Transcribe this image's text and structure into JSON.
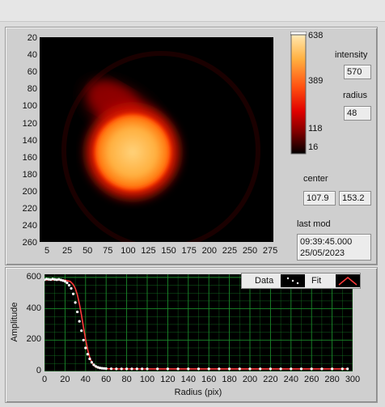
{
  "image": {
    "y_ticks": [
      "20",
      "40",
      "60",
      "80",
      "100",
      "120",
      "140",
      "160",
      "180",
      "200",
      "220",
      "240",
      "260"
    ],
    "x_ticks": [
      "5",
      "25",
      "50",
      "75",
      "100",
      "125",
      "150",
      "175",
      "200",
      "225",
      "250",
      "275"
    ]
  },
  "colorbar": {
    "ticks": [
      "638",
      "389",
      "118",
      "16"
    ],
    "colors": {
      "top": "#fff6d8",
      "upper": "#ffb040",
      "mid": "#ff2a00",
      "low": "#b80000",
      "bottom": "#000000"
    }
  },
  "readouts": {
    "intensity_label": "intensity",
    "intensity_value": "570",
    "radius_label": "radius",
    "radius_value": "48",
    "center_label": "center",
    "center_x": "107.9",
    "center_y": "153.2",
    "last_mod_label": "last mod",
    "last_mod_time": "09:39:45.000",
    "last_mod_date": "25/05/2023"
  },
  "plot": {
    "legend_data": "Data",
    "legend_fit": "Fit",
    "ylabel": "Amplitude",
    "xlabel": "Radius (pix)"
  },
  "chart_data": {
    "type": "scatter",
    "xlabel": "Radius (pix)",
    "ylabel": "Amplitude",
    "xlim": [
      0,
      300
    ],
    "ylim": [
      0,
      620
    ],
    "x_ticks": [
      0,
      20,
      40,
      60,
      80,
      100,
      120,
      140,
      160,
      180,
      200,
      220,
      240,
      260,
      280,
      300
    ],
    "y_ticks": [
      0,
      200,
      400,
      600
    ],
    "grid": true,
    "legend_position": "top-right",
    "colors": {
      "background": "#000000",
      "grid": "#1a8a2a",
      "data": "#ffffff",
      "fit": "#ff3a3a"
    },
    "series": [
      {
        "name": "Data",
        "style": "points",
        "x": [
          0,
          2,
          4,
          6,
          8,
          10,
          12,
          14,
          16,
          18,
          20,
          22,
          24,
          26,
          28,
          30,
          32,
          34,
          36,
          38,
          40,
          42,
          44,
          46,
          48,
          50,
          52,
          54,
          56,
          58,
          60,
          65,
          70,
          75,
          80,
          85,
          90,
          95,
          100,
          110,
          120,
          130,
          140,
          150,
          160,
          170,
          180,
          190,
          200,
          210,
          220,
          230,
          240,
          250,
          260,
          270,
          280,
          290,
          295
        ],
        "y": [
          585,
          590,
          588,
          586,
          590,
          587,
          585,
          588,
          584,
          580,
          575,
          565,
          550,
          530,
          495,
          440,
          380,
          320,
          260,
          200,
          150,
          110,
          80,
          58,
          42,
          32,
          26,
          22,
          20,
          19,
          18,
          17,
          16,
          16,
          16,
          16,
          16,
          16,
          16,
          16,
          16,
          16,
          16,
          16,
          16,
          16,
          16,
          16,
          16,
          16,
          16,
          16,
          16,
          16,
          16,
          16,
          16,
          16,
          16
        ]
      },
      {
        "name": "Fit",
        "style": "line",
        "x": [
          0,
          10,
          20,
          25,
          28,
          30,
          32,
          34,
          36,
          38,
          40,
          42,
          44,
          46,
          48,
          50,
          52,
          55,
          60,
          70,
          80,
          100,
          150,
          200,
          250,
          295
        ],
        "y": [
          584,
          584,
          582,
          575,
          555,
          530,
          490,
          430,
          360,
          280,
          205,
          140,
          90,
          58,
          38,
          28,
          22,
          19,
          17,
          16,
          16,
          16,
          16,
          16,
          16,
          16
        ]
      }
    ]
  }
}
